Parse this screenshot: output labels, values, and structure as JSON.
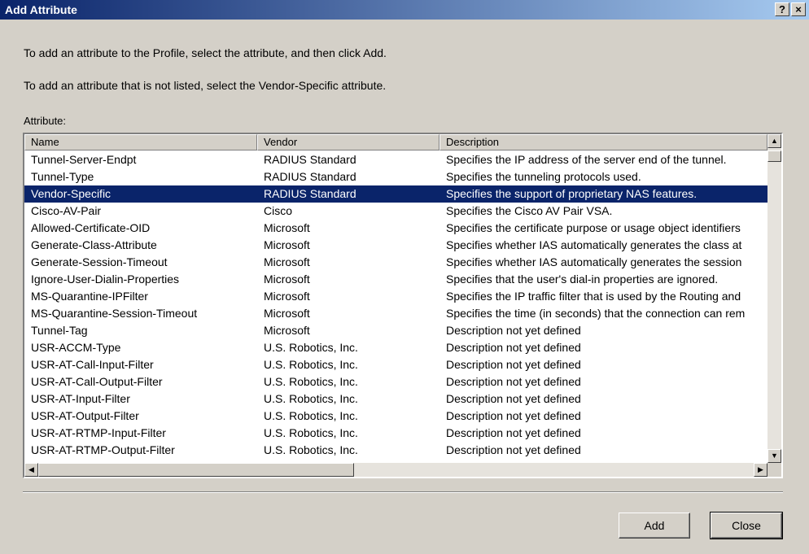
{
  "window": {
    "title": "Add Attribute",
    "help_label": "?",
    "close_label": "×"
  },
  "instructions": [
    "To add an attribute to the Profile, select the attribute, and then click Add.",
    "To add an attribute that is not listed, select the Vendor-Specific attribute."
  ],
  "attribute_label": "Attribute:",
  "columns": [
    "Name",
    "Vendor",
    "Description"
  ],
  "rows": [
    {
      "name": "Tunnel-Server-Endpt",
      "vendor": "RADIUS Standard",
      "description": "Specifies the IP address of the server end of the tunnel."
    },
    {
      "name": "Tunnel-Type",
      "vendor": "RADIUS Standard",
      "description": "Specifies the tunneling protocols used."
    },
    {
      "name": "Vendor-Specific",
      "vendor": "RADIUS Standard",
      "description": "Specifies the support of proprietary NAS features.",
      "selected": true
    },
    {
      "name": "Cisco-AV-Pair",
      "vendor": "Cisco",
      "description": "Specifies the Cisco AV Pair VSA."
    },
    {
      "name": "Allowed-Certificate-OID",
      "vendor": "Microsoft",
      "description": "Specifies the certificate purpose or usage object identifiers"
    },
    {
      "name": "Generate-Class-Attribute",
      "vendor": "Microsoft",
      "description": "Specifies whether IAS automatically generates the class at"
    },
    {
      "name": "Generate-Session-Timeout",
      "vendor": "Microsoft",
      "description": "Specifies whether IAS automatically generates the session"
    },
    {
      "name": "Ignore-User-Dialin-Properties",
      "vendor": "Microsoft",
      "description": "Specifies that the user's dial-in properties are ignored."
    },
    {
      "name": "MS-Quarantine-IPFilter",
      "vendor": "Microsoft",
      "description": "Specifies the IP traffic filter that is used by the Routing and"
    },
    {
      "name": "MS-Quarantine-Session-Timeout",
      "vendor": "Microsoft",
      "description": "Specifies the time (in seconds) that the connection can rem"
    },
    {
      "name": "Tunnel-Tag",
      "vendor": "Microsoft",
      "description": "Description not yet defined"
    },
    {
      "name": "USR-ACCM-Type",
      "vendor": "U.S. Robotics, Inc.",
      "description": "Description not yet defined"
    },
    {
      "name": "USR-AT-Call-Input-Filter",
      "vendor": "U.S. Robotics, Inc.",
      "description": "Description not yet defined"
    },
    {
      "name": "USR-AT-Call-Output-Filter",
      "vendor": "U.S. Robotics, Inc.",
      "description": "Description not yet defined"
    },
    {
      "name": "USR-AT-Input-Filter",
      "vendor": "U.S. Robotics, Inc.",
      "description": "Description not yet defined"
    },
    {
      "name": "USR-AT-Output-Filter",
      "vendor": "U.S. Robotics, Inc.",
      "description": "Description not yet defined"
    },
    {
      "name": "USR-AT-RTMP-Input-Filter",
      "vendor": "U.S. Robotics, Inc.",
      "description": "Description not yet defined"
    },
    {
      "name": "USR-AT-RTMP-Output-Filter",
      "vendor": "U.S. Robotics, Inc.",
      "description": "Description not yet defined"
    }
  ],
  "scroll_arrows": {
    "up": "▲",
    "down": "▼",
    "left": "◀",
    "right": "▶"
  },
  "buttons": {
    "add": "Add",
    "close": "Close"
  },
  "colors": {
    "titlebar_start": "#0a246a",
    "titlebar_end": "#a6caf0",
    "selection": "#0a246a",
    "face": "#d4d0c8"
  }
}
